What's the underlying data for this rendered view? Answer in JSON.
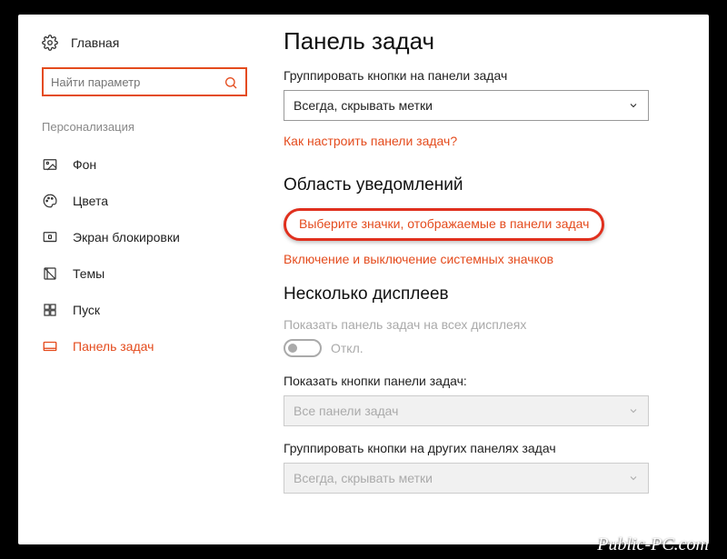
{
  "sidebar": {
    "home": "Главная",
    "search_placeholder": "Найти параметр",
    "group": "Персонализация",
    "items": [
      {
        "label": "Фон"
      },
      {
        "label": "Цвета"
      },
      {
        "label": "Экран блокировки"
      },
      {
        "label": "Темы"
      },
      {
        "label": "Пуск"
      },
      {
        "label": "Панель задач"
      }
    ]
  },
  "content": {
    "title": "Панель задач",
    "group_buttons_label": "Группировать кнопки на панели задач",
    "group_buttons_value": "Всегда, скрывать метки",
    "configure_link": "Как настроить панели задач?",
    "notif_section": "Область уведомлений",
    "select_icons_link": "Выберите значки, отображаемые в панели задач",
    "system_icons_link": "Включение и выключение системных значков",
    "multi_section": "Несколько дисплеев",
    "show_all_label": "Показать панель задач на всех дисплеях",
    "toggle_state": "Откл.",
    "show_buttons_label": "Показать кнопки панели задач:",
    "show_buttons_value": "Все панели задач",
    "group_other_label": "Группировать кнопки на других панелях задач",
    "group_other_value": "Всегда, скрывать метки"
  },
  "watermark": "Public-PC.com"
}
